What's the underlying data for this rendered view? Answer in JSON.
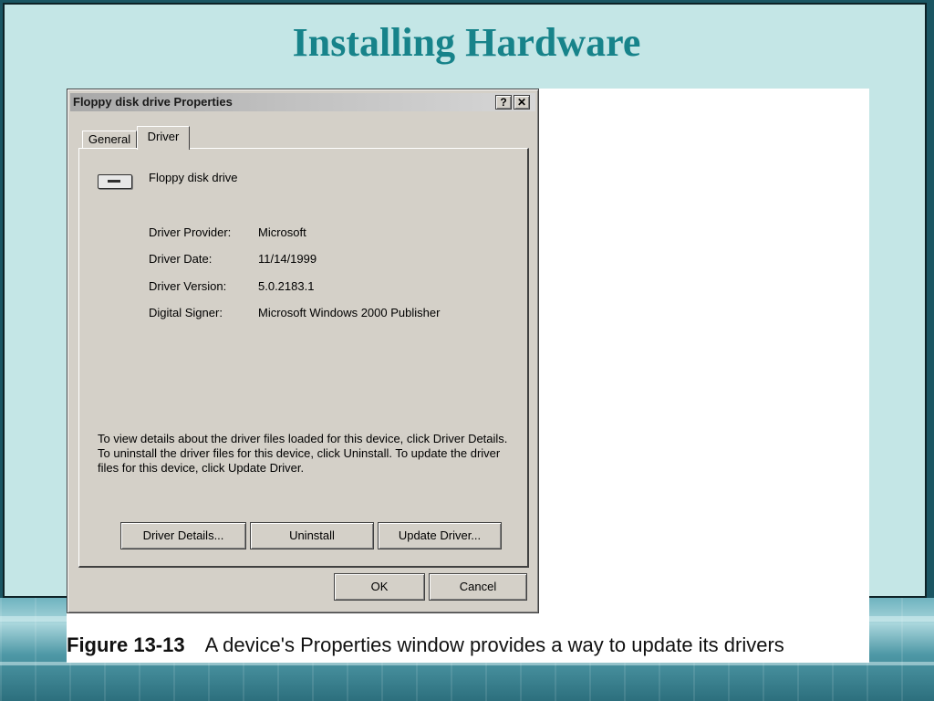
{
  "slide": {
    "title": "Installing Hardware"
  },
  "figure": {
    "caption_number": "Figure 13-13",
    "caption_text": "A device's Properties window provides a way to update its drivers"
  },
  "dialog": {
    "title": "Floppy disk drive Properties",
    "help_button": "?",
    "close_button": "✕",
    "tabs": [
      {
        "label": "General",
        "selected": false
      },
      {
        "label": "Driver",
        "selected": true
      }
    ],
    "device_icon": "floppy-drive-icon",
    "device_name": "Floppy disk drive",
    "properties": [
      {
        "label": "Driver Provider:",
        "value": "Microsoft"
      },
      {
        "label": "Driver Date:",
        "value": "11/14/1999"
      },
      {
        "label": "Driver Version:",
        "value": "5.0.2183.1"
      },
      {
        "label": "Digital Signer:",
        "value": "Microsoft Windows 2000 Publisher"
      }
    ],
    "description": "To view details about the driver files loaded for this device, click Driver Details. To uninstall the driver files for this device, click Uninstall. To update the driver files for this device, click Update Driver.",
    "buttons": {
      "driver_details": "Driver Details...",
      "uninstall": "Uninstall",
      "update_driver": "Update Driver...",
      "ok": "OK",
      "cancel": "Cancel"
    }
  }
}
